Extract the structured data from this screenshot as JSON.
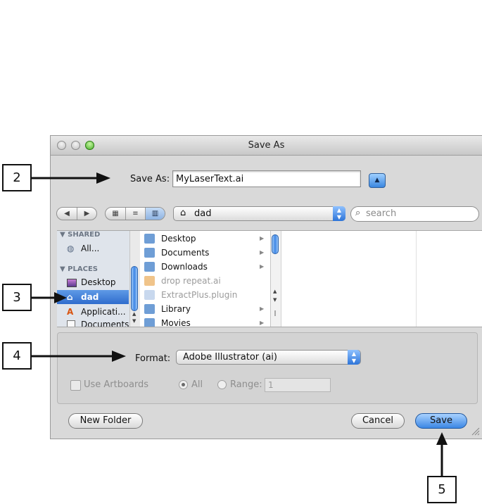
{
  "window": {
    "title": "Save As"
  },
  "save": {
    "label": "Save As:",
    "filename": "MyLaserText.ai"
  },
  "toolbar": {
    "location": "dad",
    "search_placeholder": "search"
  },
  "sidebar": {
    "shared_header": "SHARED",
    "shared_items": [
      {
        "label": "All...",
        "icon": "globe-icon"
      }
    ],
    "places_header": "PLACES",
    "places_items": [
      {
        "label": "Desktop",
        "icon": "desktop-icon"
      },
      {
        "label": "dad",
        "icon": "home-icon",
        "selected": true
      },
      {
        "label": "Applicati...",
        "icon": "applications-icon"
      },
      {
        "label": "Documents",
        "icon": "document-icon"
      }
    ]
  },
  "files": [
    {
      "name": "Desktop",
      "type": "folder",
      "enabled": true
    },
    {
      "name": "Documents",
      "type": "folder",
      "enabled": true
    },
    {
      "name": "Downloads",
      "type": "folder",
      "enabled": true
    },
    {
      "name": "drop repeat.ai",
      "type": "file",
      "enabled": false
    },
    {
      "name": "ExtractPlus.plugin",
      "type": "file",
      "enabled": false
    },
    {
      "name": "Library",
      "type": "folder",
      "enabled": true
    },
    {
      "name": "Movies",
      "type": "folder",
      "enabled": true
    }
  ],
  "options": {
    "format_label": "Format:",
    "format_value": "Adobe Illustrator (ai)",
    "use_artboards": "Use Artboards",
    "all": "All",
    "range": "Range:",
    "range_value": "1"
  },
  "buttons": {
    "new_folder": "New Folder",
    "cancel": "Cancel",
    "save": "Save"
  },
  "callouts": [
    "2",
    "3",
    "4",
    "5"
  ],
  "colors": {
    "accent": "#3b86e4",
    "selection": "#2f6ccd"
  }
}
